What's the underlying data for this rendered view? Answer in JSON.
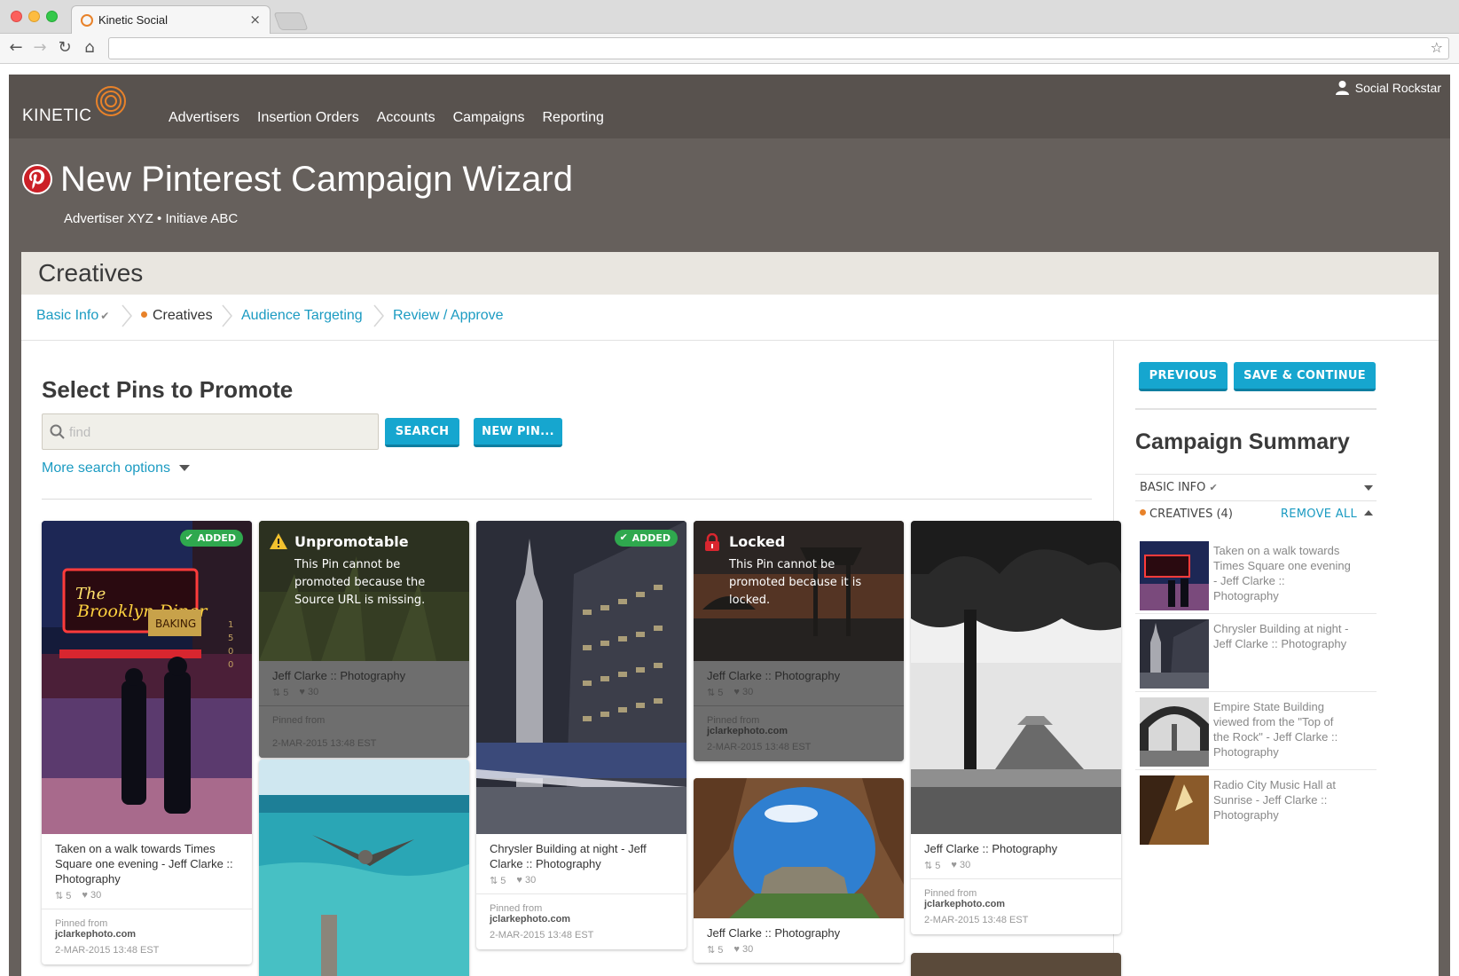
{
  "browser": {
    "tab_title": "Kinetic Social",
    "tab_close": "×",
    "back": "←",
    "forward": "→",
    "reload": "↻",
    "home": "⌂",
    "star": "☆"
  },
  "app": {
    "logo_text": "KINETIC",
    "nav": [
      "Advertisers",
      "Insertion Orders",
      "Accounts",
      "Campaigns",
      "Reporting"
    ],
    "user_name": "Social Rockstar"
  },
  "hero": {
    "title": "New Pinterest Campaign Wizard",
    "subtitle": "Advertiser XYZ • Initiave ABC"
  },
  "panel": {
    "title": "Creatives",
    "steps": [
      {
        "label": "Basic Info",
        "check": "✔"
      },
      {
        "label": "Creatives"
      },
      {
        "label": "Audience Targeting"
      },
      {
        "label": "Review / Approve"
      }
    ]
  },
  "main": {
    "section_title": "Select Pins to Promote",
    "search_placeholder": "find",
    "search_button": "SEARCH",
    "new_pin_button": "NEW PIN...",
    "more_options": "More search options"
  },
  "pins": {
    "added_label": "ADDED",
    "added_check": "✔",
    "pinned_from_label": "Pinned from",
    "site": "jclarkephoto.com",
    "date": "2-MAR-2015 13:48 EST",
    "repins": "5",
    "likes": "30",
    "p1_desc": "Taken on a walk towards Times Square one evening - Jeff Clarke :: Photography",
    "p2_desc": "Jeff Clarke :: Photography",
    "p2_title": "Unpromotable",
    "p2_text": "This Pin cannot be promoted because the Source URL is missing.",
    "p3_desc": "Chrysler Building at night - Jeff Clarke :: Photography",
    "p4_desc": "Jeff Clarke :: Photography",
    "p4_title": "Locked",
    "p4_text": "This Pin cannot be promoted because it is locked.",
    "p5_desc": "Jeff Clarke :: Photography",
    "p6_desc": "Jeff Clarke :: Photography"
  },
  "sidebar": {
    "previous": "PREVIOUS",
    "save_continue": "SAVE & CONTINUE",
    "summary_title": "Campaign Summary",
    "basic_info": "BASIC INFO",
    "basic_check": "✔",
    "creatives": "CREATIVES (4)",
    "remove_all": "REMOVE ALL",
    "items": [
      "Taken on a walk towards Times Square one evening - Jeff Clarke :: Photography",
      "Chrysler Building at night - Jeff Clarke :: Photography",
      "Empire State Building viewed from the \"Top of the Rock\" - Jeff Clarke :: Photography",
      "Radio City Music Hall at Sunrise - Jeff Clarke :: Photography"
    ]
  },
  "colors": {
    "accent": "#16a6cf",
    "link": "#1b9bc2",
    "header": "#66605c",
    "added": "#2fa84e",
    "pinterest": "#cb2027",
    "step_dot": "#e8822a"
  }
}
